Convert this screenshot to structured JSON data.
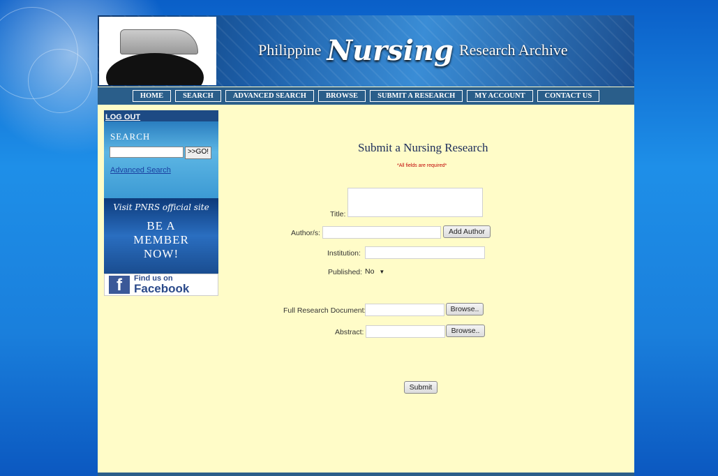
{
  "banner": {
    "title_prefix": "Philippine",
    "title_main": "Nursing",
    "title_suffix": "Research Archive"
  },
  "nav": {
    "items": [
      {
        "label": "HOME"
      },
      {
        "label": "SEARCH"
      },
      {
        "label": "ADVANCED SEARCH"
      },
      {
        "label": "BROWSE"
      },
      {
        "label": "SUBMIT A RESEARCH"
      },
      {
        "label": "MY ACCOUNT"
      },
      {
        "label": "CONTACT US"
      }
    ]
  },
  "sidebar": {
    "logout": "LOG OUT",
    "search_heading": "SEARCH",
    "search_button": ">>GO!",
    "advanced_link": "Advanced Search",
    "visit_text": "Visit PNRS official site",
    "member_text": [
      "BE A",
      "MEMBER",
      "NOW!"
    ],
    "facebook_line1": "Find us on",
    "facebook_line2": "Facebook"
  },
  "form": {
    "title": "Submit a Nursing Research",
    "required_note": "*All fields are required*",
    "title_label": "Title:",
    "author_label": "Author/s:",
    "add_author_button": "Add Author",
    "institution_label": "Institution:",
    "published_label": "Published:",
    "published_value": "No",
    "full_doc_label": "Full Research Document:",
    "browse_button": "Browse..",
    "abstract_label": "Abstract:",
    "submit_button": "Submit"
  },
  "colors": {
    "page_bg": "#fffcc8",
    "nav_bg": "#2a5e8a",
    "title_color": "#1b2b5a",
    "note_color": "#c00000",
    "desktop_blue": "#1a7fdc"
  }
}
